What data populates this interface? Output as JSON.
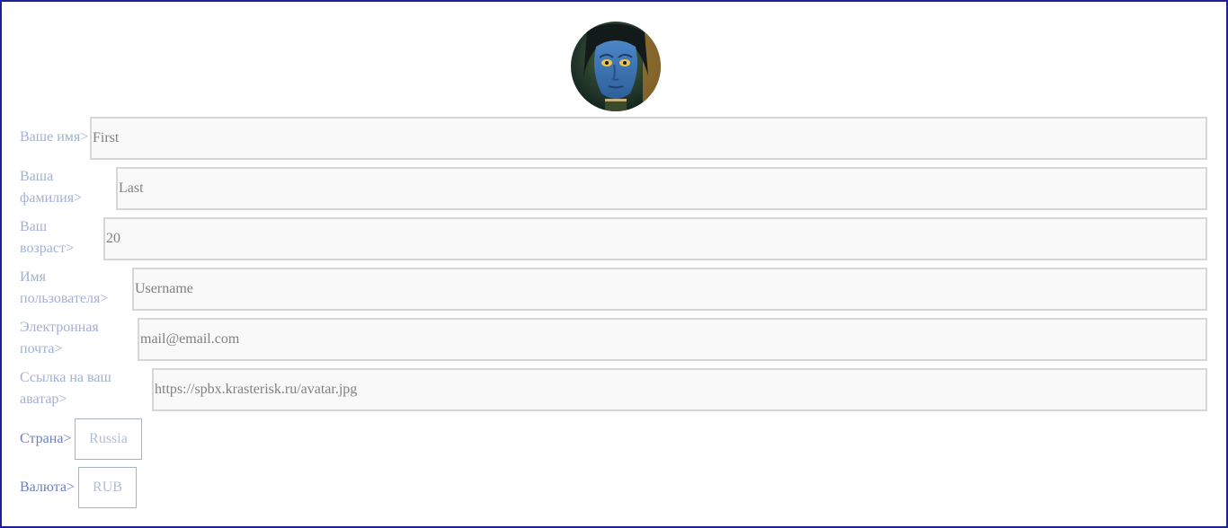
{
  "form": {
    "first_name": {
      "label": "Ваше имя>",
      "placeholder": "First"
    },
    "last_name": {
      "label": "Ваша фамилия>",
      "placeholder": "Last"
    },
    "age": {
      "label": "Ваш возраст>",
      "placeholder": "20"
    },
    "username": {
      "label": "Имя пользователя>",
      "placeholder": "Username"
    },
    "email": {
      "label": "Электронная почта>",
      "placeholder": "mail@email.com"
    },
    "avatar_url": {
      "label": "Ссылка на ваш аватар>",
      "placeholder": "https://spbx.krasterisk.ru/avatar.jpg"
    },
    "country": {
      "label": "Страна>",
      "value": "Russia"
    },
    "currency": {
      "label": "Валюта>",
      "value": "RUB"
    }
  },
  "colors": {
    "frame_border": "#1f2199",
    "label": "#a3b0d2",
    "select_label": "#6c7fbf",
    "field_border": "#d6d6d6",
    "placeholder": "#808080"
  }
}
